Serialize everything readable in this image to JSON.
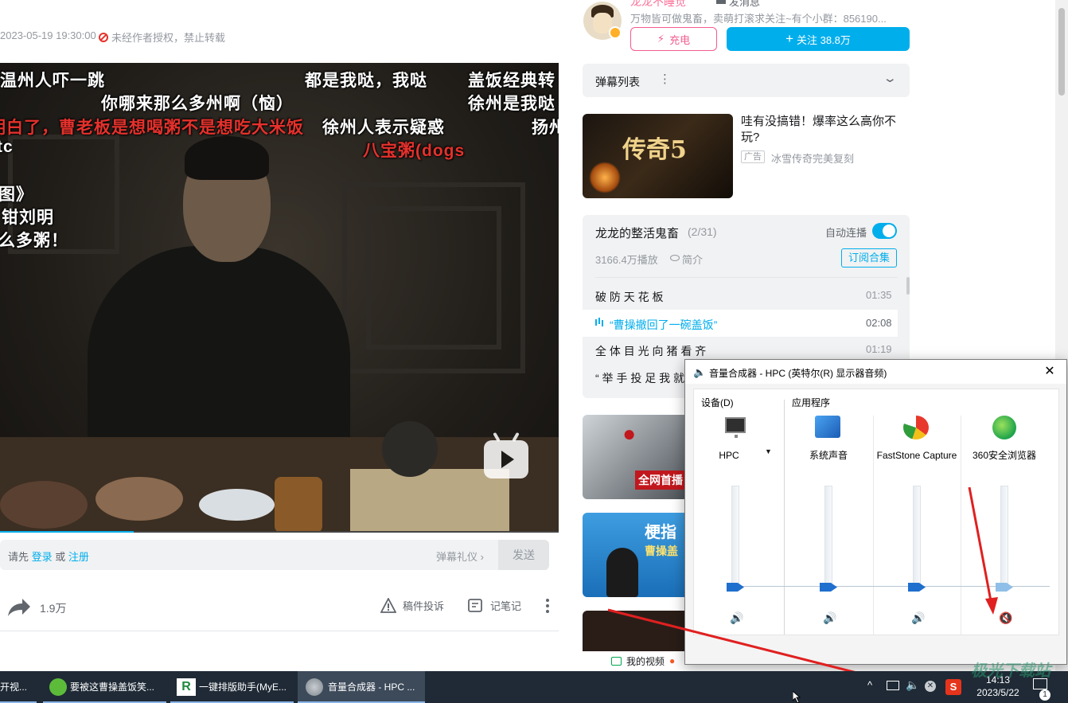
{
  "header": {
    "author_name": "龙龙不睡觉",
    "message_label": "发消息",
    "author_bio": "万物皆可做鬼畜，卖萌打滚求关注~有个小群：856190...",
    "charge_label": "充电",
    "follow_label": "关注 38.8万",
    "publish_time": "2023-05-19 19:30:00",
    "copyright_notice": "未经作者授权，禁止转载"
  },
  "danmaku": {
    "lines": [
      {
        "text": "温州人吓一跳",
        "color": "white"
      },
      {
        "text": "都是我哒，我哒",
        "color": "white"
      },
      {
        "text": "盖饭经典转",
        "color": "white"
      },
      {
        "text": "你哪来那么多州啊（恼）",
        "color": "white"
      },
      {
        "text": "徐州是我哒",
        "color": "white"
      },
      {
        "text": "明白了，曹老板是想喝粥不是想吃大米饭",
        "color": "red"
      },
      {
        "text": "徐州人表示疑惑",
        "color": "white"
      },
      {
        "text": "扬州",
        "color": "white"
      },
      {
        "text": "八宝粥(dogs",
        "color": "red"
      },
      {
        "text": "tc",
        "color": "white"
      },
      {
        "text": "图》",
        "color": "white"
      },
      {
        "text": "钳刘明",
        "color": "white"
      },
      {
        "text": "么多粥！",
        "color": "white"
      }
    ]
  },
  "video": {
    "progress": 0.24
  },
  "send_bar": {
    "prefix": "请先",
    "login": "登录",
    "or": "或",
    "register": "注册",
    "etiquette": "弹幕礼仪 ›",
    "send": "发送"
  },
  "actions": {
    "share_count": "1.9万",
    "report": "稿件投诉",
    "notes": "记笔记"
  },
  "danmaku_list": {
    "title": "弹幕列表"
  },
  "ad": {
    "title": "哇有没搞错！爆率这么高你不玩?",
    "badge": "广告",
    "source": "冰雪传奇完美复刻",
    "thumb_text": "传奇5"
  },
  "playlist": {
    "title": "龙龙的整活鬼畜",
    "count": "(2/31)",
    "autoplay_label": "自动连播",
    "plays": "3166.4万播放",
    "intro": "简介",
    "subscribe": "订阅合集",
    "episodes": [
      {
        "title": "破 防 天 花 板",
        "duration": "01:35",
        "active": false
      },
      {
        "title": "“曹操撤回了一碗盖饭”",
        "duration": "02:08",
        "active": true
      },
      {
        "title": "全 体 目 光 向 猪 看 齐",
        "duration": "01:19",
        "active": false
      },
      {
        "title": "“ 举 手 投 足 我 就",
        "duration": "",
        "active": false
      }
    ]
  },
  "recommend": {
    "thumb1_text": "全网首播",
    "thumb2_text": "梗指",
    "thumb2_sub": "曹操盖"
  },
  "bottom_bar": {
    "my_videos": "我的视频"
  },
  "mixer": {
    "title": "音量合成器 - HPC (英特尔(R) 显示器音频)",
    "devices_label": "设备(D)",
    "apps_label": "应用程序",
    "device": {
      "name": "HPC",
      "level": 0.0,
      "muted": false
    },
    "apps": [
      {
        "name": "系统声音",
        "level": 0.0,
        "muted": false
      },
      {
        "name": "FastStone Capture",
        "level": 0.0,
        "muted": false
      },
      {
        "name": "360安全浏览器",
        "level": 0.0,
        "muted": true
      }
    ]
  },
  "taskbar": {
    "items": [
      {
        "label": "开视..."
      },
      {
        "label": "要被这曹操盖饭笑..."
      },
      {
        "label": "一键排版助手(MyE..."
      },
      {
        "label": "音量合成器 - HPC ..."
      }
    ],
    "time": "14:13",
    "date": "2023/5/22",
    "notification_count": "1"
  },
  "watermark": "极光下载站",
  "colors": {
    "accent": "#00aeec",
    "charge": "#f25d8e",
    "annotation_arrow": "#e02020"
  }
}
